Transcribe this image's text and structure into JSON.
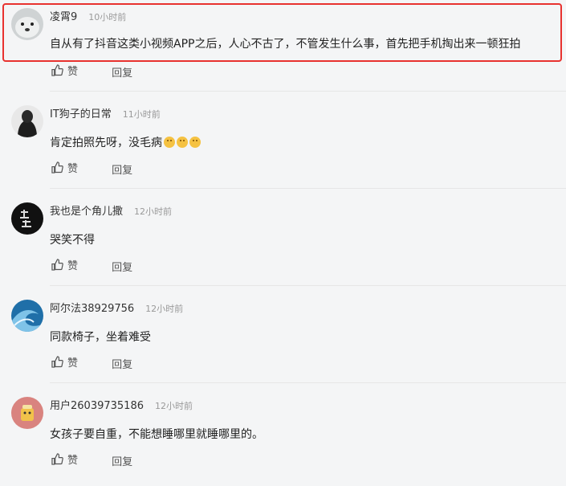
{
  "comments": [
    {
      "name": "凌霄9",
      "time": "10小时前",
      "text": "自从有了抖音这类小视频APP之后，人心不古了，不管发生什么事，首先把手机掏出来一顿狂拍",
      "like": "赞",
      "reply": "回复",
      "avatar": "seal-avatar"
    },
    {
      "name": "IT狗子的日常",
      "time": "11小时前",
      "text": "肯定拍照先呀，没毛病",
      "like": "赞",
      "reply": "回复",
      "avatar": "hooded-figure-avatar",
      "emoji_count": 3
    },
    {
      "name": "我也是个角儿撒",
      "time": "12小时前",
      "text": "哭笑不得",
      "like": "赞",
      "reply": "回复",
      "avatar": "calligraphy-avatar"
    },
    {
      "name": "阿尔法38929756",
      "time": "12小时前",
      "text": "同款椅子，坐着难受",
      "like": "赞",
      "reply": "回复",
      "avatar": "wave-avatar"
    },
    {
      "name": "用户26039735186",
      "time": "12小时前",
      "text": "女孩子要自重，不能想睡哪里就睡哪里的。",
      "like": "赞",
      "reply": "回复",
      "avatar": "cartoon-avatar"
    }
  ],
  "colors": {
    "highlight": "#e8322f",
    "background": "#f4f5f6"
  }
}
